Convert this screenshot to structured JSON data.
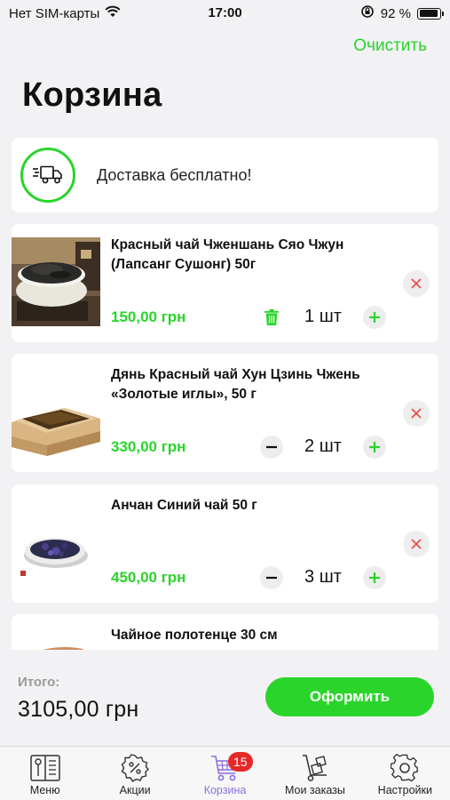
{
  "status_bar": {
    "carrier": "Нет SIM-карты",
    "time": "17:00",
    "battery": "92 %",
    "battery_level": 0.92
  },
  "header": {
    "clear_label": "Очистить",
    "title": "Корзина"
  },
  "delivery": {
    "text": "Доставка бесплатно!",
    "icon": "truck-icon"
  },
  "items": [
    {
      "name": "Красный чай Чженшань Сяо Чжун (Лапсанг Сушонг)  50г",
      "price": "150,00 грн",
      "quantity": "1 шт",
      "decrement_icon": "trash-icon"
    },
    {
      "name": "Дянь Красный чай Хун Цзинь Чжень «Золотые иглы», 50 г",
      "price": "330,00 грн",
      "quantity": "2 шт",
      "decrement_icon": "minus-icon"
    },
    {
      "name": "Анчан Синий чай 50 г",
      "price": "450,00 грн",
      "quantity": "3 шт",
      "decrement_icon": "minus-icon"
    },
    {
      "name": "Чайное полотенце 30 см"
    }
  ],
  "checkout": {
    "total_label": "Итого:",
    "total_value": "3105,00 грн",
    "button_label": "Оформить"
  },
  "tabs": [
    {
      "label": "Меню",
      "icon": "menu-book-icon"
    },
    {
      "label": "Акции",
      "icon": "discount-gear-icon"
    },
    {
      "label": "Корзина",
      "icon": "cart-icon",
      "badge": "15",
      "active": true
    },
    {
      "label": "Мои заказы",
      "icon": "hand-truck-icon"
    },
    {
      "label": "Настройки",
      "icon": "gear-icon"
    }
  ],
  "colors": {
    "accent": "#2bd42b",
    "active_tab": "#8a6fe0",
    "badge": "#e62828",
    "remove_x": "#e8504a"
  }
}
